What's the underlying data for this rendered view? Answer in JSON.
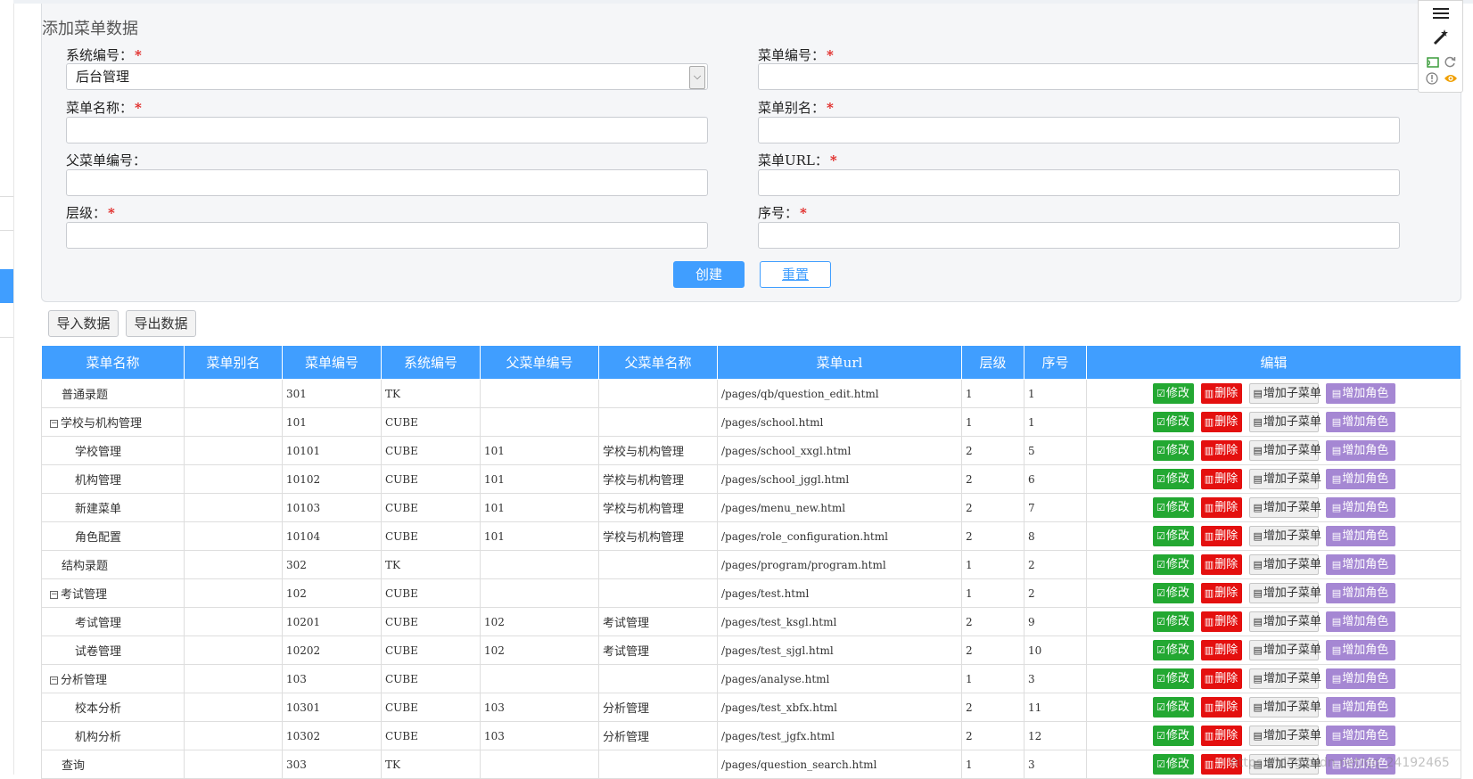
{
  "form": {
    "title": "添加菜单数据",
    "fields": {
      "system_no": {
        "label": "系统编号：",
        "required": true,
        "value": "后台管理"
      },
      "menu_no": {
        "label": "菜单编号：",
        "required": true,
        "value": ""
      },
      "menu_name": {
        "label": "菜单名称：",
        "required": true,
        "value": ""
      },
      "menu_alias": {
        "label": "菜单别名：",
        "required": true,
        "value": ""
      },
      "parent_no": {
        "label": "父菜单编号：",
        "required": false,
        "value": ""
      },
      "menu_url": {
        "label": "菜单URL：",
        "required": true,
        "value": ""
      },
      "level": {
        "label": "层级：",
        "required": true,
        "value": ""
      },
      "order": {
        "label": "序号：",
        "required": true,
        "value": ""
      }
    },
    "required_mark": "*",
    "create_label": "创建",
    "reset_label": "重置"
  },
  "toolbar": {
    "import_label": "导入数据",
    "export_label": "导出数据"
  },
  "mini_toolbar": {
    "icons": [
      "menu-icon",
      "magic-wand-icon",
      "cast-icon",
      "refresh-icon",
      "info-icon",
      "eye-icon"
    ]
  },
  "table": {
    "headers": [
      "菜单名称",
      "菜单别名",
      "菜单编号",
      "系统编号",
      "父菜单编号",
      "父菜单名称",
      "菜单url",
      "层级",
      "序号",
      "编辑"
    ],
    "actions": {
      "edit": "修改",
      "delete": "删除",
      "add_submenu": "增加子菜单",
      "add_role": "增加角色"
    },
    "rows": [
      {
        "name": "普通录题",
        "alias": "",
        "no": "301",
        "sys": "TK",
        "pno": "",
        "pname": "",
        "url": "/pages/qb/question_edit.html",
        "level": "1",
        "order": "1",
        "depth": 1,
        "has_children": false
      },
      {
        "name": "学校与机构管理",
        "alias": "",
        "no": "101",
        "sys": "CUBE",
        "pno": "",
        "pname": "",
        "url": "/pages/school.html",
        "level": "1",
        "order": "1",
        "depth": 1,
        "has_children": true
      },
      {
        "name": "学校管理",
        "alias": "",
        "no": "10101",
        "sys": "CUBE",
        "pno": "101",
        "pname": "学校与机构管理",
        "url": "/pages/school_xxgl.html",
        "level": "2",
        "order": "5",
        "depth": 2,
        "has_children": false
      },
      {
        "name": "机构管理",
        "alias": "",
        "no": "10102",
        "sys": "CUBE",
        "pno": "101",
        "pname": "学校与机构管理",
        "url": "/pages/school_jggl.html",
        "level": "2",
        "order": "6",
        "depth": 2,
        "has_children": false
      },
      {
        "name": "新建菜单",
        "alias": "",
        "no": "10103",
        "sys": "CUBE",
        "pno": "101",
        "pname": "学校与机构管理",
        "url": "/pages/menu_new.html",
        "level": "2",
        "order": "7",
        "depth": 2,
        "has_children": false
      },
      {
        "name": "角色配置",
        "alias": "",
        "no": "10104",
        "sys": "CUBE",
        "pno": "101",
        "pname": "学校与机构管理",
        "url": "/pages/role_configuration.html",
        "level": "2",
        "order": "8",
        "depth": 2,
        "has_children": false
      },
      {
        "name": "结构录题",
        "alias": "",
        "no": "302",
        "sys": "TK",
        "pno": "",
        "pname": "",
        "url": "/pages/program/program.html",
        "level": "1",
        "order": "2",
        "depth": 1,
        "has_children": false
      },
      {
        "name": "考试管理",
        "alias": "",
        "no": "102",
        "sys": "CUBE",
        "pno": "",
        "pname": "",
        "url": "/pages/test.html",
        "level": "1",
        "order": "2",
        "depth": 1,
        "has_children": true
      },
      {
        "name": "考试管理",
        "alias": "",
        "no": "10201",
        "sys": "CUBE",
        "pno": "102",
        "pname": "考试管理",
        "url": "/pages/test_ksgl.html",
        "level": "2",
        "order": "9",
        "depth": 2,
        "has_children": false
      },
      {
        "name": "试卷管理",
        "alias": "",
        "no": "10202",
        "sys": "CUBE",
        "pno": "102",
        "pname": "考试管理",
        "url": "/pages/test_sjgl.html",
        "level": "2",
        "order": "10",
        "depth": 2,
        "has_children": false
      },
      {
        "name": "分析管理",
        "alias": "",
        "no": "103",
        "sys": "CUBE",
        "pno": "",
        "pname": "",
        "url": "/pages/analyse.html",
        "level": "1",
        "order": "3",
        "depth": 1,
        "has_children": true
      },
      {
        "name": "校本分析",
        "alias": "",
        "no": "10301",
        "sys": "CUBE",
        "pno": "103",
        "pname": "分析管理",
        "url": "/pages/test_xbfx.html",
        "level": "2",
        "order": "11",
        "depth": 2,
        "has_children": false
      },
      {
        "name": "机构分析",
        "alias": "",
        "no": "10302",
        "sys": "CUBE",
        "pno": "103",
        "pname": "分析管理",
        "url": "/pages/test_jgfx.html",
        "level": "2",
        "order": "12",
        "depth": 2,
        "has_children": false
      },
      {
        "name": "查询",
        "alias": "",
        "no": "303",
        "sys": "TK",
        "pno": "",
        "pname": "",
        "url": "/pages/question_search.html",
        "level": "1",
        "order": "3",
        "depth": 1,
        "has_children": false
      }
    ]
  },
  "watermark": "https://blog.csdn.net/qq_24192465"
}
